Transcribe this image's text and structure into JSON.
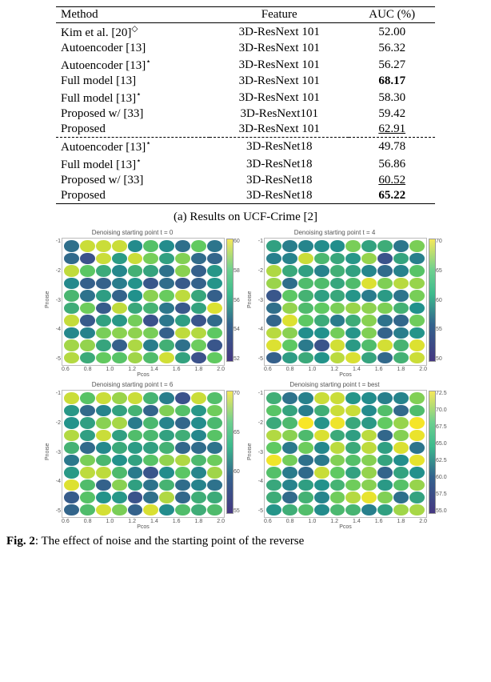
{
  "table": {
    "headers": [
      "Method",
      "Feature",
      "AUC (%)"
    ],
    "rows": [
      {
        "method": "Kim et al. [20]",
        "sup": "◇",
        "feature": "3D-ResNext 101",
        "auc": "52.00",
        "style": ""
      },
      {
        "method": "Autoencoder [13]",
        "sup": "",
        "feature": "3D-ResNext 101",
        "auc": "56.32",
        "style": ""
      },
      {
        "method": "Autoencoder [13]",
        "sup": "⋆",
        "feature": "3D-ResNext 101",
        "auc": "56.27",
        "style": ""
      },
      {
        "method": "Full model [13]",
        "sup": "",
        "feature": "3D-ResNext 101",
        "auc": "68.17",
        "style": "bold"
      },
      {
        "method": "Full model [13]",
        "sup": "⋆",
        "feature": "3D-ResNext 101",
        "auc": "58.30",
        "style": ""
      },
      {
        "method": "Proposed w/ [33]",
        "sup": "",
        "feature": "3D-ResNext101",
        "auc": "59.42",
        "style": ""
      },
      {
        "method": "Proposed",
        "sup": "",
        "feature": "3D-ResNext 101",
        "auc": "62.91",
        "style": "underline"
      },
      {
        "method": "Autoencoder [13]",
        "sup": "⋆",
        "feature": "3D-ResNet18",
        "auc": "49.78",
        "style": "",
        "sep": true
      },
      {
        "method": "Full model [13]",
        "sup": "⋆",
        "feature": "3D-ResNet18",
        "auc": "56.86",
        "style": ""
      },
      {
        "method": "Proposed w/ [33]",
        "sup": "",
        "feature": "3D-ResNet18",
        "auc": "60.52",
        "style": "underline"
      },
      {
        "method": "Proposed",
        "sup": "",
        "feature": "3D-ResNet18",
        "auc": "65.22",
        "style": "bold",
        "last": true
      }
    ]
  },
  "caption_a": "(a) Results on UCF-Crime [2]",
  "charts": {
    "panels": [
      {
        "title": "Denoising starting point t = 0",
        "cmin": 52,
        "cmax": 60,
        "cticks": [
          "60",
          "58",
          "56",
          "54",
          "52"
        ]
      },
      {
        "title": "Denoising starting point t = 4",
        "cmin": 50,
        "cmax": 70,
        "cticks": [
          "70",
          "65",
          "60",
          "55",
          "50"
        ]
      },
      {
        "title": "Denoising starting point t = 6",
        "cmin": 55,
        "cmax": 70,
        "cticks": [
          "70",
          "65",
          "60",
          "55"
        ]
      },
      {
        "title": "Denoising starting point t = best",
        "cmin": 55,
        "cmax": 73,
        "cticks": [
          "72.5",
          "70.0",
          "67.5",
          "65.0",
          "62.5",
          "60.0",
          "57.5",
          "55.0"
        ]
      }
    ],
    "yticks": [
      "-1",
      "-2",
      "-3",
      "-4",
      "-5"
    ],
    "ylabel": "Pnoise",
    "xticks": [
      "0.6",
      "0.8",
      "1.0",
      "1.2",
      "1.4",
      "1.6",
      "1.8",
      "2.0"
    ],
    "xlabel": "Pcos"
  },
  "fig_caption_prefix": "Fig. 2",
  "fig_caption_rest": ": The effect of noise and the starting point of the reverse "
}
